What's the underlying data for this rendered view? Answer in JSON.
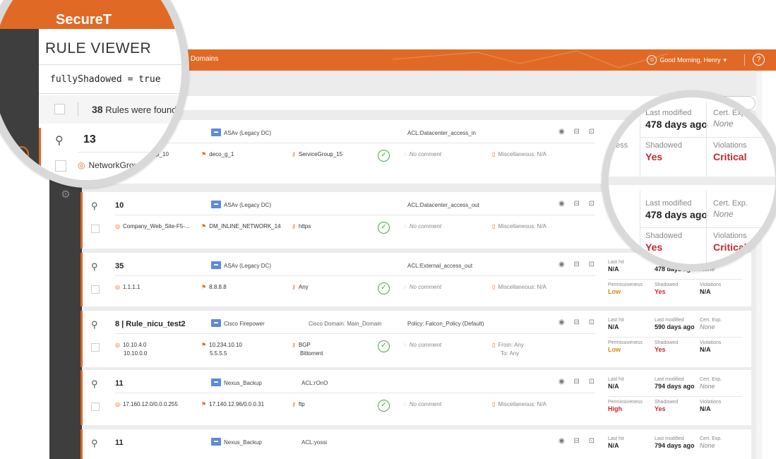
{
  "app": {
    "brand": "SecureT",
    "page_title": "RULE VIEWER"
  },
  "header": {
    "domains": "All Domains",
    "greeting": "Good Morning, Henry",
    "help": "?"
  },
  "query": {
    "text": "fullyShadowed = true"
  },
  "results": {
    "count": "38",
    "label": "Rules were found"
  },
  "magnified_rule": {
    "number": "13",
    "source": "NetworkGroup_10"
  },
  "magnified_stats": {
    "access_partial": "ess",
    "last_modified_label": "Last modified",
    "last_modified_value": "478 days ago",
    "cert_label": "Cert. Exp.",
    "cert_value": "None",
    "shadowed_label": "Shadowed",
    "shadowed_value": "Yes",
    "violations_label": "Violations",
    "violations_value": "Critical",
    "permissiveness_partial": "Pe",
    "low_partial": "Low"
  },
  "stat_labels": {
    "last_hit": "Last hit",
    "last_modified": "Last modified",
    "cert": "Cert. Exp.",
    "permissiveness": "Permissiveness",
    "shadowed": "Shadowed",
    "violations": "Violations"
  },
  "rules": [
    {
      "number": "13",
      "device": "ASAv (Legacy DC)",
      "domain": "",
      "acl": "ACL:Datacenter_access_in",
      "src": [
        "NetworkGroup_10"
      ],
      "dst": [
        "deco_g_1"
      ],
      "svc": [
        "ServiceGroup_15"
      ],
      "comment": "No comment",
      "misc": [
        "Miscellaneous: N/A"
      ],
      "last_hit": "",
      "last_modified": "",
      "cert": "",
      "permissiveness": "",
      "shadowed": "",
      "violations": ""
    },
    {
      "number": "10",
      "device": "ASAv (Legacy DC)",
      "domain": "",
      "acl": "ACL:Datacenter_access_out",
      "src": [
        "Company_Web_Site-F5-..."
      ],
      "dst": [
        "DM_INLINE_NETWORK_14"
      ],
      "svc": [
        "https"
      ],
      "comment": "No comment",
      "misc": [
        "Miscellaneous: N/A"
      ],
      "last_hit": "",
      "last_modified": "",
      "cert": "",
      "permissiveness": "",
      "shadowed": "",
      "violations": ""
    },
    {
      "number": "35",
      "device": "ASAv (Legacy DC)",
      "domain": "",
      "acl": "ACL:External_access_out",
      "src": [
        "1.1.1.1"
      ],
      "dst": [
        "8.8.8.8"
      ],
      "svc": [
        "Any"
      ],
      "comment": "No comment",
      "misc": [
        "Miscellaneous: N/A"
      ],
      "last_hit": "N/A",
      "last_modified": "478 days ago",
      "cert": "None",
      "permissiveness": "Low",
      "shadowed": "Yes",
      "violations": "N/A"
    },
    {
      "number": "8 | Rule_nicu_test2",
      "device": "Cisco Firepower",
      "domain": "Cisco Domain: Main_Domain",
      "acl": "Policy: Falcon_Policy (Default)",
      "src": [
        "10.10.4.0",
        "10.10.0.0"
      ],
      "dst": [
        "10.234.10.10",
        "5.5.5.5"
      ],
      "svc": [
        "BGP",
        "Bittorrent"
      ],
      "comment": "No comment",
      "misc": [
        "From: Any",
        "To: Any"
      ],
      "last_hit": "N/A",
      "last_modified": "590 days ago",
      "cert": "None",
      "permissiveness": "Low",
      "shadowed": "Yes",
      "violations": "N/A"
    },
    {
      "number": "11",
      "device": "Nexus_Backup",
      "domain": "",
      "acl": "ACL:rOnO",
      "src": [
        "17.160.12.0/0.0.0.255"
      ],
      "dst": [
        "17.140.12.96/0.0.0.31"
      ],
      "svc": [
        "ftp"
      ],
      "comment": "No comment",
      "misc": [
        "Miscellaneous: N/A"
      ],
      "last_hit": "N/A",
      "last_modified": "794 days ago",
      "cert": "None",
      "permissiveness": "High",
      "shadowed": "Yes",
      "violations": "N/A"
    },
    {
      "number": "11",
      "device": "Nexus_Backup",
      "domain": "",
      "acl": "ACL:yossi",
      "src": [],
      "dst": [],
      "svc": [],
      "comment": "",
      "misc": [],
      "last_hit": "N/A",
      "last_modified": "794 days ago",
      "cert": "None",
      "permissiveness": "",
      "shadowed": "",
      "violations": ""
    }
  ],
  "icons": {
    "pin": "pin-icon",
    "source": "location-pin-icon",
    "destination": "flag-icon",
    "service": "key-icon",
    "comment": "comment-icon",
    "misc": "document-icon",
    "status": "check-circle-icon",
    "search": "search-icon",
    "doc": "document-icon",
    "settings": "gear-icon"
  },
  "colors": {
    "accent": "#e06a25",
    "rail": "#3e3e3e",
    "ok": "#4aa84a",
    "danger": "#c8282c",
    "warn": "#d48a1a"
  }
}
